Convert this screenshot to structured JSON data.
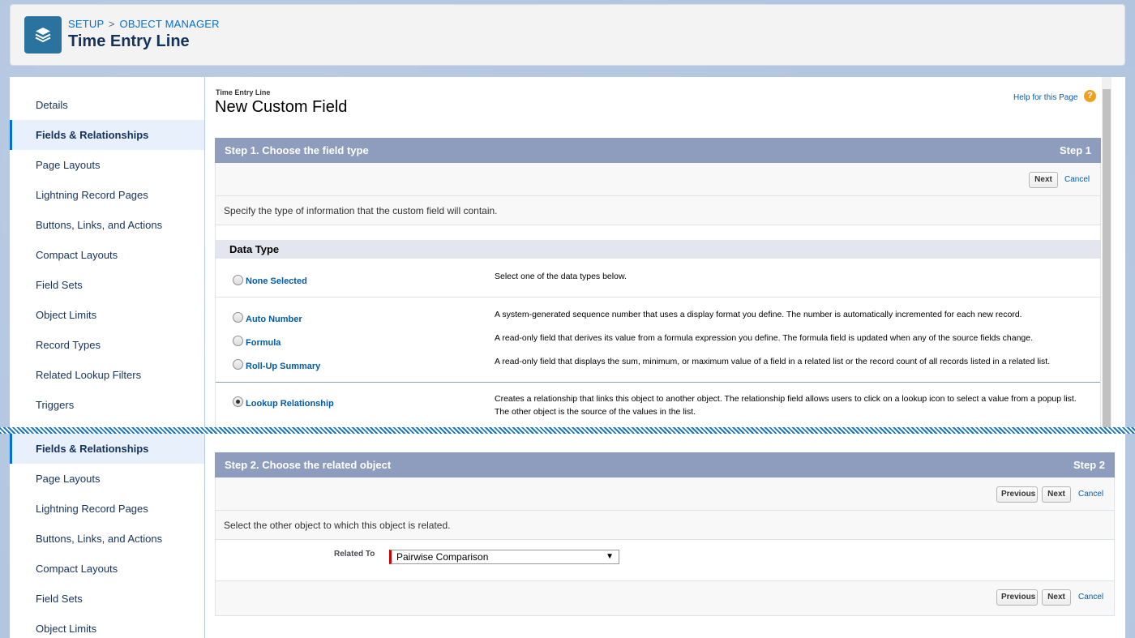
{
  "header": {
    "breadcrumb": {
      "setup": "SETUP",
      "sep": ">",
      "object_manager": "OBJECT MANAGER"
    },
    "title": "Time Entry Line",
    "icon": "layers-icon"
  },
  "sidebar_top": {
    "items": [
      {
        "label": "Details",
        "active": false
      },
      {
        "label": "Fields & Relationships",
        "active": true
      },
      {
        "label": "Page Layouts",
        "active": false
      },
      {
        "label": "Lightning Record Pages",
        "active": false
      },
      {
        "label": "Buttons, Links, and Actions",
        "active": false
      },
      {
        "label": "Compact Layouts",
        "active": false
      },
      {
        "label": "Field Sets",
        "active": false
      },
      {
        "label": "Object Limits",
        "active": false
      },
      {
        "label": "Record Types",
        "active": false
      },
      {
        "label": "Related Lookup Filters",
        "active": false
      },
      {
        "label": "Triggers",
        "active": false
      }
    ]
  },
  "sidebar_bottom": {
    "items": [
      {
        "label": "Fields & Relationships",
        "active": true
      },
      {
        "label": "Page Layouts",
        "active": false
      },
      {
        "label": "Lightning Record Pages",
        "active": false
      },
      {
        "label": "Buttons, Links, and Actions",
        "active": false
      },
      {
        "label": "Compact Layouts",
        "active": false
      },
      {
        "label": "Field Sets",
        "active": false
      },
      {
        "label": "Object Limits",
        "active": false
      }
    ]
  },
  "page": {
    "object_name": "Time Entry Line",
    "title": "New Custom Field",
    "help_link": "Help for this Page",
    "help_icon": "?"
  },
  "step1": {
    "title": "Step 1. Choose the field type",
    "step_label": "Step 1",
    "next": "Next",
    "cancel": "Cancel",
    "instructions": "Specify the type of information that the custom field will contain.",
    "section_title": "Data Type",
    "types": [
      {
        "label": "None Selected",
        "desc": "Select one of the data types below.",
        "checked": false
      },
      {
        "label": "Auto Number",
        "desc": "A system-generated sequence number that uses a display format you define. The number is automatically incremented for each new record.",
        "checked": false
      },
      {
        "label": "Formula",
        "desc": "A read-only field that derives its value from a formula expression you define. The formula field is updated when any of the source fields change.",
        "checked": false
      },
      {
        "label": "Roll-Up Summary",
        "desc": "A read-only field that displays the sum, minimum, or maximum value of a field in a related list or the record count of all records listed in a related list.",
        "checked": false
      },
      {
        "label": "Lookup Relationship",
        "desc": "Creates a relationship that links this object to another object. The relationship field allows users to click on a lookup icon to select a value from a popup list. The other object is the source of the values in the list.",
        "checked": true
      }
    ]
  },
  "step2": {
    "title": "Step 2. Choose the related object",
    "step_label": "Step 2",
    "previous": "Previous",
    "next": "Next",
    "cancel": "Cancel",
    "instructions": "Select the other object to which this object is related.",
    "related_to_label": "Related To",
    "related_to_value": "Pairwise Comparison",
    "select_arrow": "▼"
  }
}
